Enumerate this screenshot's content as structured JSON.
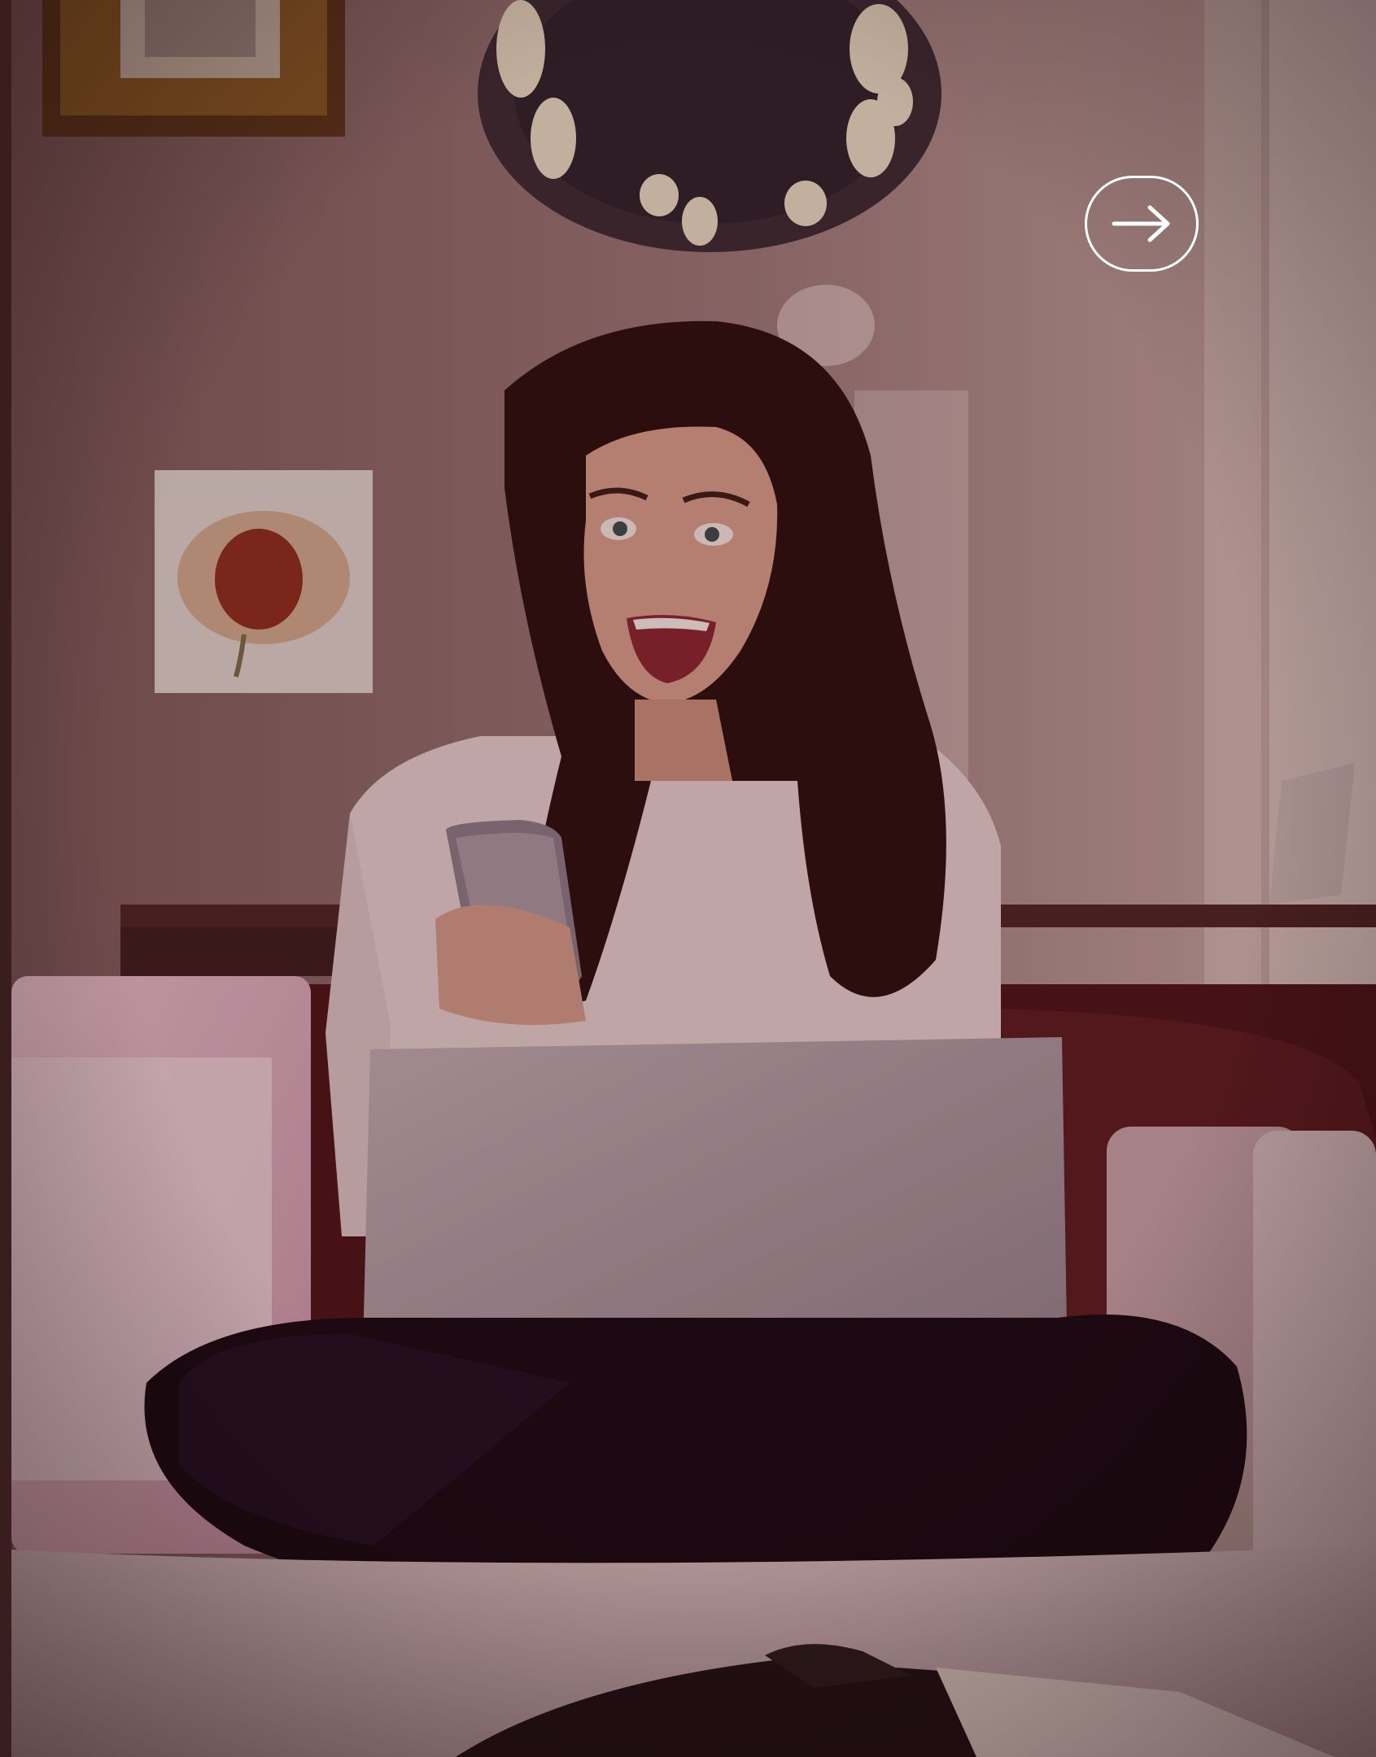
{
  "photo": {
    "subject": "excited-woman-with-phone-and-laptop",
    "tint_color": "#3a1016"
  },
  "overlay_controls": {
    "next_button": {
      "icon": "arrow-right-icon",
      "color": "#ffffff"
    }
  }
}
